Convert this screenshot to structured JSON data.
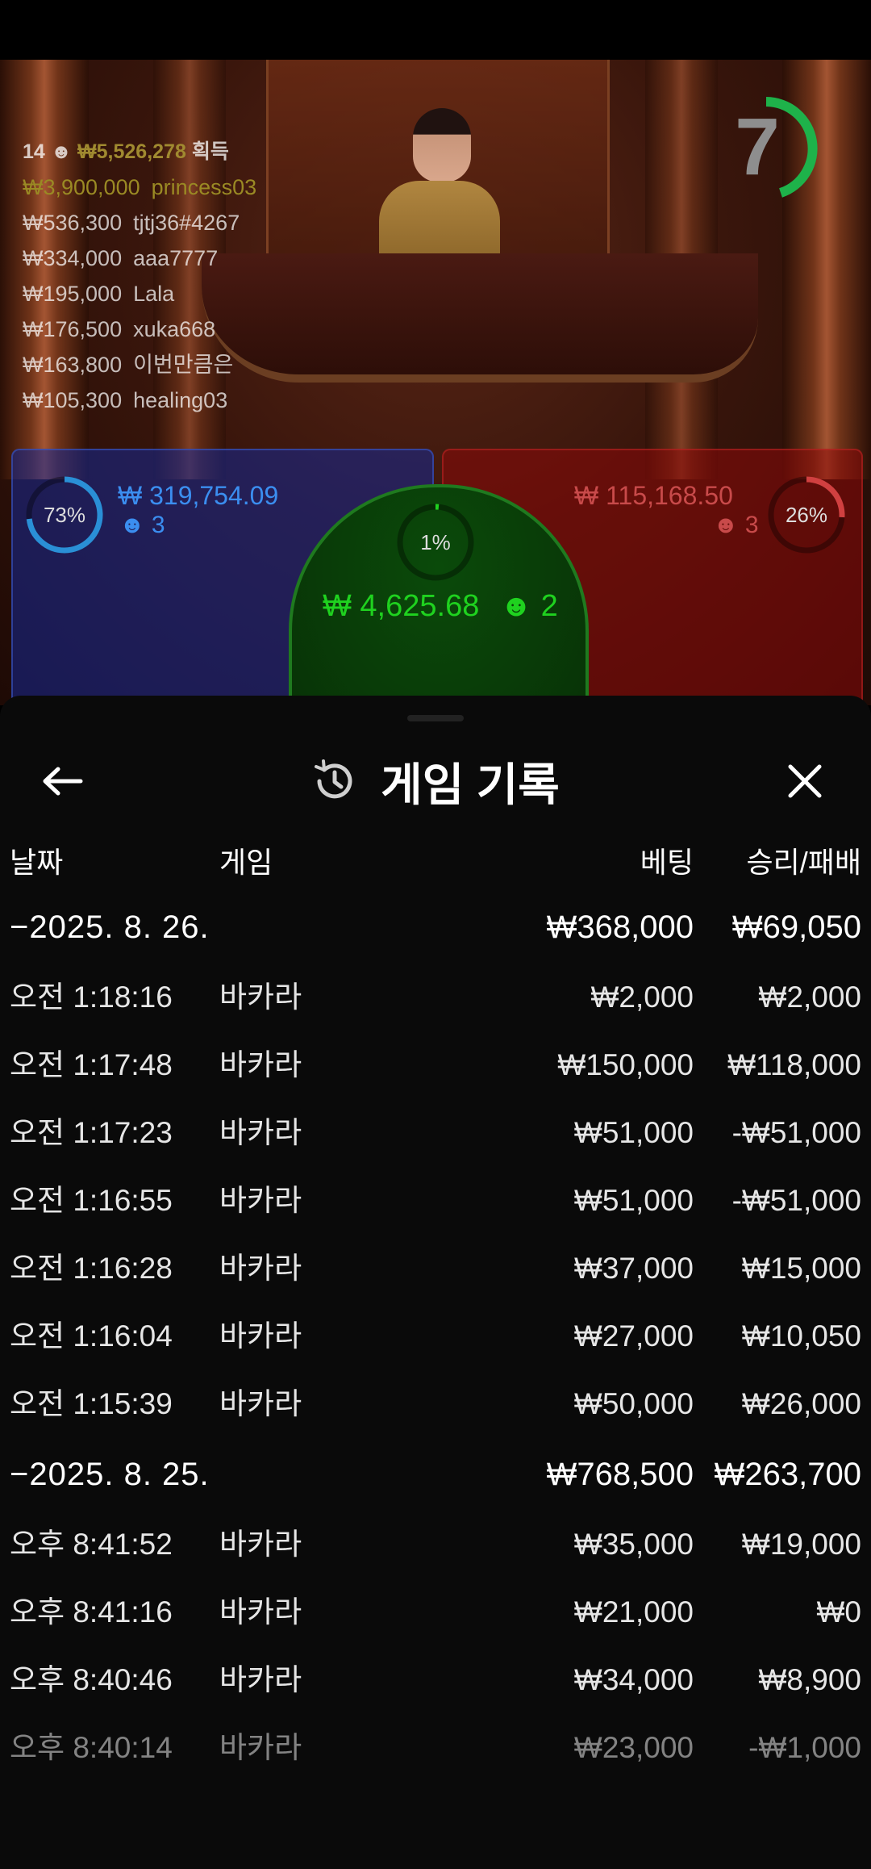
{
  "live": {
    "round_count": "14",
    "total_won": "₩5,526,278",
    "total_won_suffix": "획득",
    "winners": [
      {
        "amount": "₩3,900,000",
        "name": "princess03"
      },
      {
        "amount": "₩536,300",
        "name": "tjtj36#4267"
      },
      {
        "amount": "₩334,000",
        "name": "aaa7777"
      },
      {
        "amount": "₩195,000",
        "name": "Lala"
      },
      {
        "amount": "₩176,500",
        "name": "xuka668"
      },
      {
        "amount": "₩163,800",
        "name": "이번만큼은"
      },
      {
        "amount": "₩105,300",
        "name": "healing03"
      }
    ],
    "timer": "7",
    "bets": {
      "player": {
        "percent": "73%",
        "amount": "₩ 319,754.09",
        "people": "3",
        "color": "#3b8ef0"
      },
      "banker": {
        "percent": "26%",
        "amount": "₩ 115,168.50",
        "people": "3",
        "color": "#c84a4a"
      },
      "tie": {
        "percent": "1%",
        "amount": "₩ 4,625.68",
        "people": "2",
        "color": "#1fd21f"
      }
    }
  },
  "history": {
    "title": "게임 기록",
    "icons": {
      "back": "arrow-left-icon",
      "history": "history-clock-icon",
      "close": "close-x-icon"
    },
    "columns": {
      "date": "날짜",
      "game": "게임",
      "bet": "베팅",
      "result": "승리/패배"
    },
    "groups": [
      {
        "date": "2025. 8. 26.",
        "total_bet": "₩368,000",
        "total_result": "₩69,050",
        "rows": [
          {
            "time": "오전 1:18:16",
            "game": "바카라",
            "bet": "₩2,000",
            "result": "₩2,000"
          },
          {
            "time": "오전 1:17:48",
            "game": "바카라",
            "bet": "₩150,000",
            "result": "₩118,000"
          },
          {
            "time": "오전 1:17:23",
            "game": "바카라",
            "bet": "₩51,000",
            "result": "-₩51,000"
          },
          {
            "time": "오전 1:16:55",
            "game": "바카라",
            "bet": "₩51,000",
            "result": "-₩51,000"
          },
          {
            "time": "오전 1:16:28",
            "game": "바카라",
            "bet": "₩37,000",
            "result": "₩15,000"
          },
          {
            "time": "오전 1:16:04",
            "game": "바카라",
            "bet": "₩27,000",
            "result": "₩10,050"
          },
          {
            "time": "오전 1:15:39",
            "game": "바카라",
            "bet": "₩50,000",
            "result": "₩26,000"
          }
        ]
      },
      {
        "date": "2025. 8. 25.",
        "total_bet": "₩768,500",
        "total_result": "₩263,700",
        "rows": [
          {
            "time": "오후 8:41:52",
            "game": "바카라",
            "bet": "₩35,000",
            "result": "₩19,000"
          },
          {
            "time": "오후 8:41:16",
            "game": "바카라",
            "bet": "₩21,000",
            "result": "₩0"
          },
          {
            "time": "오후 8:40:46",
            "game": "바카라",
            "bet": "₩34,000",
            "result": "₩8,900"
          },
          {
            "time": "오후 8:40:14",
            "game": "바카라",
            "bet": "₩23,000",
            "result": "-₩1,000"
          }
        ]
      }
    ]
  }
}
